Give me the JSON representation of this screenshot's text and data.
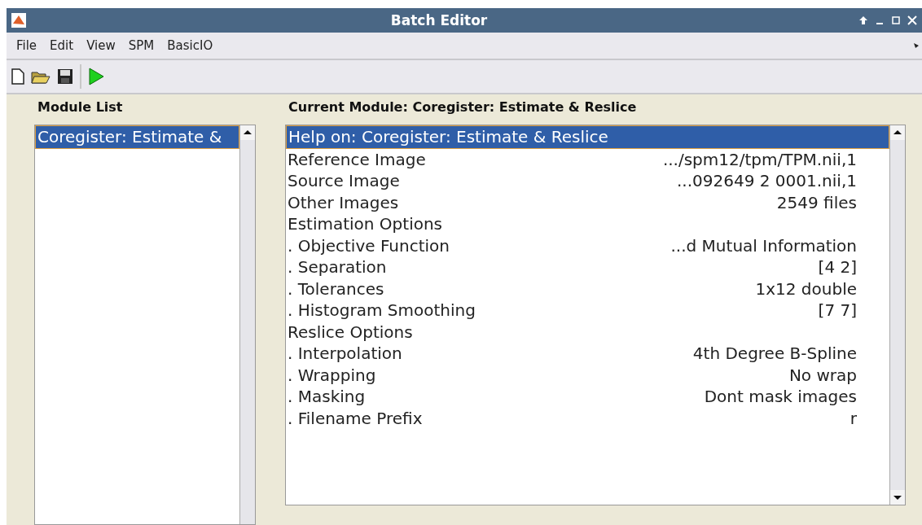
{
  "window": {
    "title": "Batch Editor",
    "controls": [
      {
        "kind": "up"
      },
      {
        "kind": "minimize"
      },
      {
        "kind": "maximize"
      },
      {
        "kind": "close"
      }
    ]
  },
  "menu": [
    "File",
    "Edit",
    "View",
    "SPM",
    "BasicIO"
  ],
  "toolbar": [
    {
      "kind": "new"
    },
    {
      "kind": "open"
    },
    {
      "kind": "save"
    },
    {
      "kind": "run"
    }
  ],
  "module_list": {
    "title": "Module List",
    "items": [
      {
        "label": "Coregister: Estimate &",
        "selected": true
      }
    ]
  },
  "current_module": {
    "title": "Current Module: Coregister: Estimate & Reslice",
    "rows": [
      {
        "label": "Help on: Coregister: Estimate & Reslice",
        "selected": true
      },
      {
        "label": "Reference Image",
        "value": ".../spm12/tpm/TPM.nii,1",
        "selected": false
      },
      {
        "label": "Source Image",
        "value": "...092649 2 0001.nii,1",
        "selected": false
      },
      {
        "label": "Other Images",
        "value": "2549 files",
        "selected": false
      },
      {
        "label": "Estimation Options",
        "selected": false
      },
      {
        "label": ". Objective Function",
        "value": "...d Mutual Information",
        "selected": false
      },
      {
        "label": ". Separation",
        "value": "[4 2]",
        "selected": false
      },
      {
        "label": ". Tolerances",
        "value": "1x12 double",
        "selected": false
      },
      {
        "label": ". Histogram Smoothing",
        "value": "[7 7]",
        "selected": false
      },
      {
        "label": "Reslice Options",
        "selected": false
      },
      {
        "label": ". Interpolation",
        "value": "4th Degree B-Spline",
        "selected": false
      },
      {
        "label": ". Wrapping",
        "value": "No wrap",
        "selected": false
      },
      {
        "label": ". Masking",
        "value": "Dont mask images",
        "selected": false
      },
      {
        "label": ". Filename Prefix",
        "value": "r",
        "selected": false
      }
    ]
  }
}
